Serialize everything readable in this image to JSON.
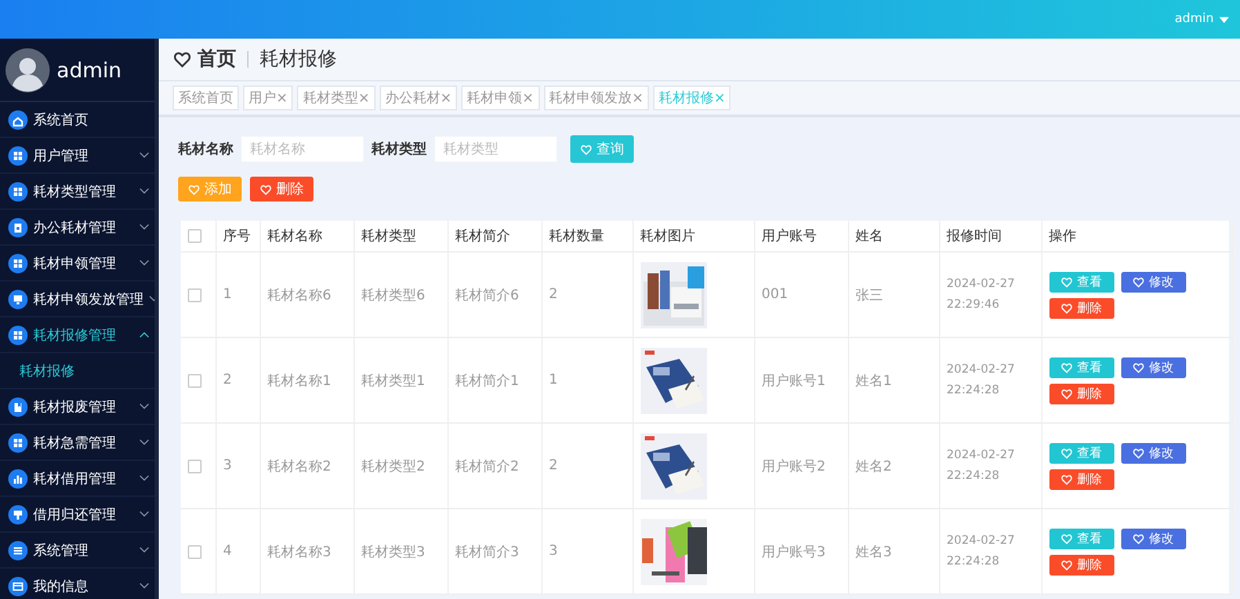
{
  "topbar": {
    "user": "admin"
  },
  "sidebar": {
    "username": "admin",
    "items": [
      {
        "label": "系统首页",
        "kind": "home",
        "selected": false
      },
      {
        "label": "用户管理",
        "kind": "grid",
        "selected": false,
        "expanded": false
      },
      {
        "label": "耗材类型管理",
        "kind": "grid",
        "selected": false,
        "expanded": false
      },
      {
        "label": "办公耗材管理",
        "kind": "clipboard",
        "selected": false,
        "expanded": false
      },
      {
        "label": "耗材申领管理",
        "kind": "grid",
        "selected": false,
        "expanded": false
      },
      {
        "label": "耗材申领发放管理",
        "kind": "monitor",
        "selected": false,
        "expanded": false
      },
      {
        "label": "耗材报修管理",
        "kind": "grid",
        "selected": true,
        "expanded": true,
        "children": [
          {
            "label": "耗材报修",
            "selected": true
          }
        ]
      },
      {
        "label": "耗材报废管理",
        "kind": "book",
        "selected": false,
        "expanded": false
      },
      {
        "label": "耗材急需管理",
        "kind": "grid",
        "selected": false,
        "expanded": false
      },
      {
        "label": "耗材借用管理",
        "kind": "chart",
        "selected": false,
        "expanded": false
      },
      {
        "label": "借用归还管理",
        "kind": "stamp",
        "selected": false,
        "expanded": false
      },
      {
        "label": "系统管理",
        "kind": "list",
        "selected": false,
        "expanded": false
      },
      {
        "label": "我的信息",
        "kind": "card",
        "selected": false,
        "expanded": false
      }
    ]
  },
  "breadcrumb": [
    {
      "label": "首页"
    },
    {
      "label": "耗材报修"
    }
  ],
  "tags": [
    {
      "label": "系统首页",
      "selected": false
    },
    {
      "label": "用户",
      "close": "×",
      "selected": false
    },
    {
      "label": "耗材类型",
      "close": "×",
      "selected": false
    },
    {
      "label": "办公耗材",
      "close": "×",
      "selected": false
    },
    {
      "label": "耗材申领",
      "close": "×",
      "selected": false
    },
    {
      "label": "耗材申领发放",
      "close": "×",
      "selected": false
    },
    {
      "label": "耗材报修",
      "close": "×",
      "selected": true
    }
  ],
  "search": {
    "fields": [
      {
        "label": "耗材名称",
        "placeholder": "耗材名称"
      },
      {
        "label": "耗材类型",
        "placeholder": "耗材类型"
      }
    ],
    "button": "查询"
  },
  "toolbar": [
    {
      "label": "添加",
      "kind": "add"
    },
    {
      "label": "删除",
      "kind": "delete"
    }
  ],
  "table": {
    "select_all": {
      "checked": false
    },
    "columns": [
      "序号",
      "耗材名称",
      "耗材类型",
      "耗材简介",
      "耗材数量",
      "耗材图片",
      "用户账号",
      "姓名",
      "报修时间",
      "操作"
    ],
    "rows": [
      {
        "checked": false,
        "cells": [
          "1",
          "耗材名称6",
          "耗材类型6",
          "耗材简介6",
          "2",
          {
            "kind": "picture"
          },
          "001",
          "张三",
          "2024-02-27 22:29:46"
        ],
        "actions": [
          {
            "label": "查看",
            "kind": "view"
          },
          {
            "label": "修改",
            "kind": "edit"
          },
          {
            "label": "删除",
            "kind": "delete"
          }
        ]
      },
      {
        "checked": false,
        "cells": [
          "2",
          "耗材名称1",
          "耗材类型1",
          "耗材简介1",
          "1",
          {
            "kind": "picture"
          },
          "用户账号1",
          "姓名1",
          "2024-02-27 22:24:28"
        ],
        "actions": [
          {
            "label": "查看",
            "kind": "view"
          },
          {
            "label": "修改",
            "kind": "edit"
          },
          {
            "label": "删除",
            "kind": "delete"
          }
        ]
      },
      {
        "checked": false,
        "cells": [
          "3",
          "耗材名称2",
          "耗材类型2",
          "耗材简介2",
          "2",
          {
            "kind": "picture"
          },
          "用户账号2",
          "姓名2",
          "2024-02-27 22:24:28"
        ],
        "actions": [
          {
            "label": "查看",
            "kind": "view"
          },
          {
            "label": "修改",
            "kind": "edit"
          },
          {
            "label": "删除",
            "kind": "delete"
          }
        ]
      },
      {
        "checked": false,
        "cells": [
          "4",
          "耗材名称3",
          "耗材类型3",
          "耗材简介3",
          "3",
          {
            "kind": "picture"
          },
          "用户账号3",
          "姓名3",
          "2024-02-27 22:24:28"
        ],
        "actions": [
          {
            "label": "查看",
            "kind": "view"
          },
          {
            "label": "修改",
            "kind": "edit"
          },
          {
            "label": "删除",
            "kind": "delete"
          }
        ]
      }
    ]
  }
}
